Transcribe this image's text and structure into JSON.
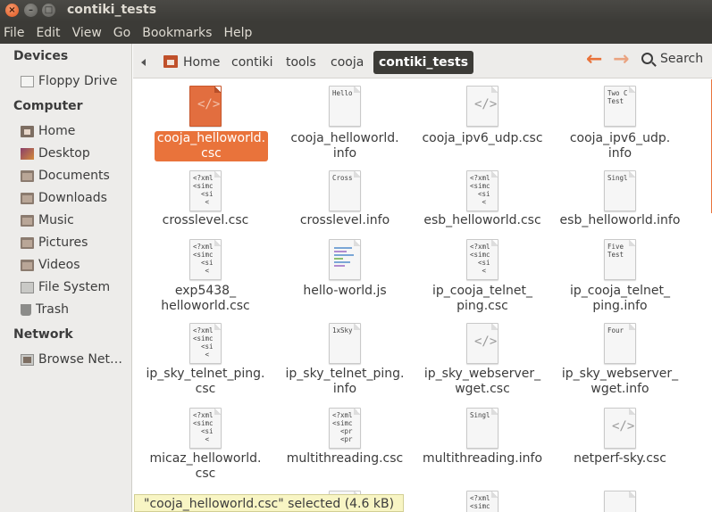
{
  "window": {
    "title": "contiki_tests"
  },
  "menu": [
    "File",
    "Edit",
    "View",
    "Go",
    "Bookmarks",
    "Help"
  ],
  "sidebar": {
    "devices_header": "Devices",
    "devices": [
      "Floppy Drive"
    ],
    "computer_header": "Computer",
    "computer": [
      "Home",
      "Desktop",
      "Documents",
      "Downloads",
      "Music",
      "Pictures",
      "Videos",
      "File System",
      "Trash"
    ],
    "network_header": "Network",
    "network": [
      "Browse Net…"
    ]
  },
  "breadcrumb": [
    "Home",
    "contiki",
    "tools",
    "cooja",
    "contiki_tests"
  ],
  "search": {
    "label": "Search"
  },
  "files": [
    {
      "name1": "cooja_helloworld.",
      "name2": "csc",
      "preview": "",
      "selected": true
    },
    {
      "name1": "cooja_helloworld.",
      "name2": "info",
      "preview": "Hello"
    },
    {
      "name1": "cooja_ipv6_udp.csc",
      "name2": "",
      "preview": ""
    },
    {
      "name1": "cooja_ipv6_udp.",
      "name2": "info",
      "preview": "Two C\nTest"
    },
    {
      "name1": "crosslevel.csc",
      "name2": "",
      "preview": "<?xml\n<simc\n  <si\n   <"
    },
    {
      "name1": "crosslevel.info",
      "name2": "",
      "preview": "Cross"
    },
    {
      "name1": "esb_helloworld.csc",
      "name2": "",
      "preview": "<?xml\n<simc\n  <si\n   <"
    },
    {
      "name1": "esb_helloworld.info",
      "name2": "",
      "preview": "Singl"
    },
    {
      "name1": "exp5438_",
      "name2": "helloworld.csc",
      "preview": "<?xml\n<simc\n  <si\n   <"
    },
    {
      "name1": "hello-world.js",
      "name2": "",
      "preview": ""
    },
    {
      "name1": "ip_cooja_telnet_",
      "name2": "ping.csc",
      "preview": "<?xml\n<simc\n  <si\n   <"
    },
    {
      "name1": "ip_cooja_telnet_",
      "name2": "ping.info",
      "preview": "Five\nTest"
    },
    {
      "name1": "ip_sky_telnet_ping.",
      "name2": "csc",
      "preview": "<?xml\n<simc\n  <si\n   <"
    },
    {
      "name1": "ip_sky_telnet_ping.",
      "name2": "info",
      "preview": "1xSky"
    },
    {
      "name1": "ip_sky_webserver_",
      "name2": "wget.csc",
      "preview": ""
    },
    {
      "name1": "ip_sky_webserver_",
      "name2": "wget.info",
      "preview": "Four"
    },
    {
      "name1": "micaz_helloworld.",
      "name2": "csc",
      "preview": "<?xml\n<simc\n  <si\n   <"
    },
    {
      "name1": "multithreading.csc",
      "name2": "",
      "preview": "<?xml\n<simc\n  <pr\n  <pr"
    },
    {
      "name1": "multithreading.info",
      "name2": "",
      "preview": "Singl"
    },
    {
      "name1": "netperf-sky.csc",
      "name2": "",
      "preview": ""
    }
  ],
  "partial_previews": [
    "<?xml\n<simc"
  ],
  "status": "\"cooja_helloworld.csc\" selected (4.6 kB)",
  "colors": {
    "accent": "#e9733b",
    "titlebar": "#3c3b37",
    "sidebar": "#edecea"
  }
}
